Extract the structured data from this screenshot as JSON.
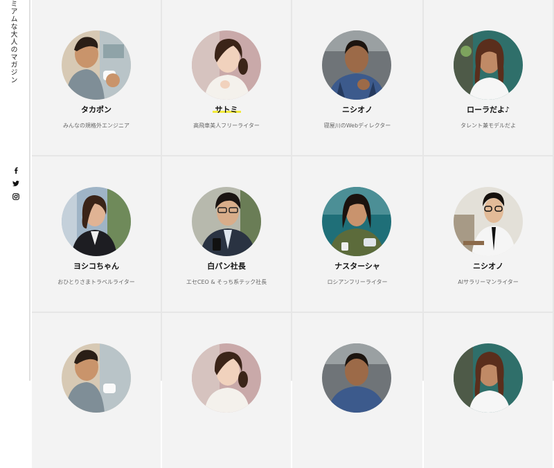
{
  "sidebar": {
    "title": "ミアムな大人のマガジン",
    "social": [
      {
        "icon": "facebook-icon",
        "glyph": "f"
      },
      {
        "icon": "twitter-icon",
        "glyph": "t"
      },
      {
        "icon": "instagram-icon",
        "glyph": "i"
      }
    ]
  },
  "writers": [
    {
      "name": "タカポン",
      "desc": "みんなの規格外エンジニア",
      "highlight": false
    },
    {
      "name": "サトミ",
      "desc": "高飛車美人フリーライター",
      "highlight": true
    },
    {
      "name": "ニシオノ",
      "desc": "寝屋川のWebディレクター",
      "highlight": false
    },
    {
      "name": "ローラだよ♪",
      "desc": "タレント兼モデルだよ",
      "highlight": false
    },
    {
      "name": "ヨシコちゃん",
      "desc": "おひとりさまトラベルライター",
      "highlight": false
    },
    {
      "name": "白パン社長",
      "desc": "エセCEO & そっち系テック社長",
      "highlight": false
    },
    {
      "name": "ナスターシャ",
      "desc": "ロシアンフリーライター",
      "highlight": false
    },
    {
      "name": "ニシオノ",
      "desc": "AIサラリーマンライター",
      "highlight": false
    },
    {
      "name": "",
      "desc": "",
      "highlight": false
    },
    {
      "name": "",
      "desc": "",
      "highlight": false
    },
    {
      "name": "",
      "desc": "",
      "highlight": false
    },
    {
      "name": "",
      "desc": "",
      "highlight": false
    }
  ],
  "colors": {
    "highlight": "#f2ea3a",
    "card_bg": "#f3f3f3"
  }
}
